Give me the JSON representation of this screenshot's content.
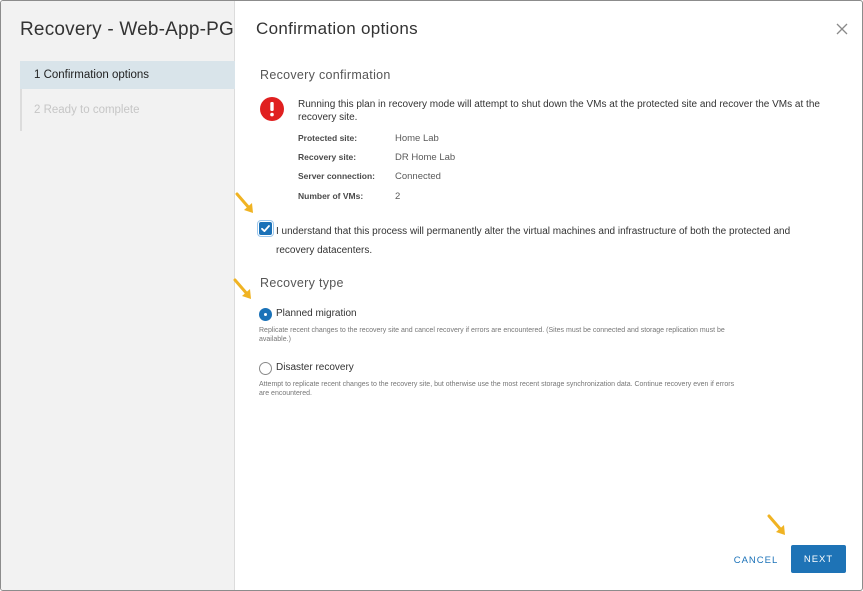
{
  "wizard": {
    "title": "Recovery - Web-App-PG",
    "steps": [
      {
        "label": "1  Confirmation options",
        "state": "active"
      },
      {
        "label": "2  Ready to complete",
        "state": "disabled"
      }
    ]
  },
  "page": {
    "title": "Confirmation options",
    "close_icon": "close-icon"
  },
  "recovery_confirmation": {
    "title": "Recovery confirmation",
    "alert_icon": "error-exclamation-icon",
    "alert_color": "#e02020",
    "alert_text": "Running this plan in recovery mode will attempt to shut down the VMs at the protected site and recover the VMs at the recovery site.",
    "details": [
      {
        "key": "Protected site:",
        "value": "Home Lab"
      },
      {
        "key": "Recovery site:",
        "value": "DR Home Lab"
      },
      {
        "key": "Server connection:",
        "value": "Connected"
      },
      {
        "key": "Number of VMs:",
        "value": "2"
      }
    ],
    "acknowledge": {
      "checked": true,
      "label": "I understand that this process will permanently alter the virtual machines and infrastructure of both the protected and recovery datacenters."
    }
  },
  "recovery_type": {
    "title": "Recovery type",
    "options": [
      {
        "label": "Planned migration",
        "selected": true,
        "description": "Replicate recent changes to the recovery site and cancel recovery if errors are encountered. (Sites must be connected and storage replication must be available.)"
      },
      {
        "label": "Disaster recovery",
        "selected": false,
        "description": "Attempt to replicate recent changes to the recovery site, but otherwise use the most recent storage synchronization data. Continue recovery even if errors are encountered."
      }
    ]
  },
  "footer": {
    "cancel_label": "CANCEL",
    "next_label": "NEXT"
  },
  "colors": {
    "accent": "#1b72b8",
    "annotation_arrow": "#f0b323"
  }
}
